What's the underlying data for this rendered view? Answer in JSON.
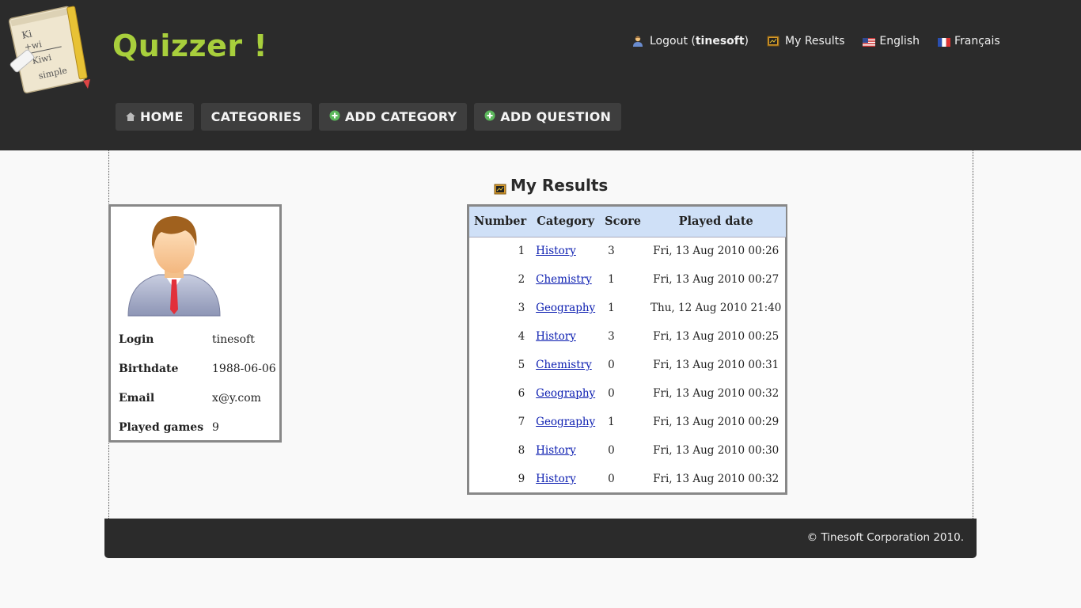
{
  "app": {
    "title": "Quizzer !"
  },
  "topnav": {
    "logout_label": "Logout (",
    "username": "tinesoft",
    "logout_close": ")",
    "my_results_label": "My Results",
    "english_label": "English",
    "french_label": "Français"
  },
  "mainnav": {
    "home_label": "HOME",
    "categories_label": "CATEGORIES",
    "add_category_label": "ADD CATEGORY",
    "add_question_label": "ADD QUESTION"
  },
  "results": {
    "heading": "My Results",
    "columns": [
      "Number",
      "Category",
      "Score",
      "Played date"
    ],
    "rows": [
      {
        "number": "1",
        "category": "History",
        "score": "3",
        "date": "Fri, 13 Aug 2010 00:26"
      },
      {
        "number": "2",
        "category": "Chemistry",
        "score": "1",
        "date": "Fri, 13 Aug 2010 00:27"
      },
      {
        "number": "3",
        "category": "Geography",
        "score": "1",
        "date": "Thu, 12 Aug 2010 21:40"
      },
      {
        "number": "4",
        "category": "History",
        "score": "3",
        "date": "Fri, 13 Aug 2010 00:25"
      },
      {
        "number": "5",
        "category": "Chemistry",
        "score": "0",
        "date": "Fri, 13 Aug 2010 00:31"
      },
      {
        "number": "6",
        "category": "Geography",
        "score": "0",
        "date": "Fri, 13 Aug 2010 00:32"
      },
      {
        "number": "7",
        "category": "Geography",
        "score": "1",
        "date": "Fri, 13 Aug 2010 00:29"
      },
      {
        "number": "8",
        "category": "History",
        "score": "0",
        "date": "Fri, 13 Aug 2010 00:30"
      },
      {
        "number": "9",
        "category": "History",
        "score": "0",
        "date": "Fri, 13 Aug 2010 00:32"
      }
    ]
  },
  "profile": {
    "login_label": "Login",
    "login_value": "tinesoft",
    "birthdate_label": "Birthdate",
    "birthdate_value": "1988-06-06",
    "email_label": "Email",
    "email_value": "x@y.com",
    "played_label": "Played games",
    "played_value": "9"
  },
  "footer": {
    "copyright": "© Tinesoft Corporation 2010."
  },
  "colors": {
    "header_bg": "#2b2b2b",
    "accent_green": "#a8cf3c",
    "table_header_bg": "#cfe0f7",
    "link": "#0a1cb0"
  },
  "icons": [
    "notepad-logo-icon",
    "user-icon",
    "results-icon",
    "us-flag-icon",
    "fr-flag-icon",
    "home-icon",
    "add-icon",
    "avatar-icon"
  ]
}
